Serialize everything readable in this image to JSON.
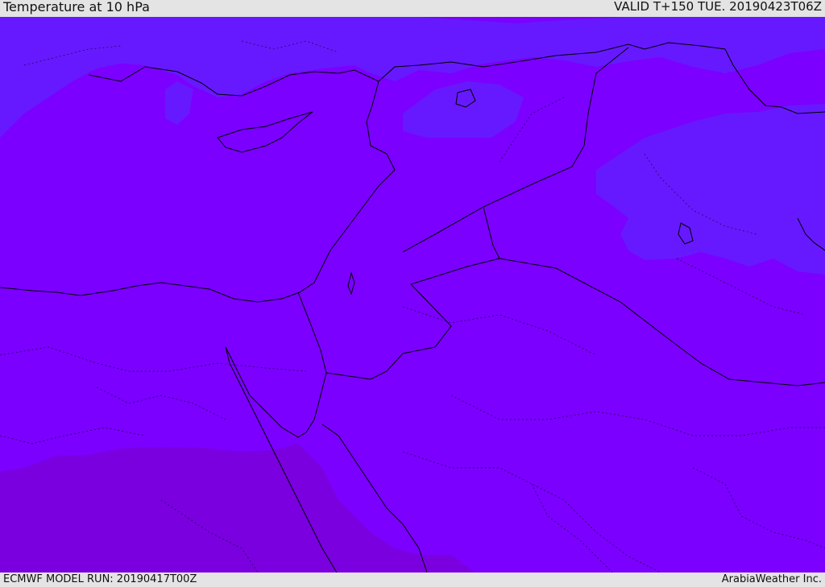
{
  "header": {
    "title": "Temperature at 10 hPa",
    "valid": "VALID T+150 TUE. 20190423T06Z"
  },
  "footer": {
    "model_run": "ECMWF MODEL RUN: 20190417T00Z",
    "credit": "ArabiaWeather Inc."
  },
  "colors": {
    "frame": "#e4e4e4",
    "base_fill": "#7b00ff",
    "cool_fill": "#6619ff",
    "warm_fill": "#7a00e0",
    "coastline": "#000000"
  }
}
